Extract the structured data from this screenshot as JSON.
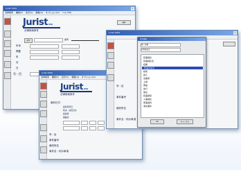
{
  "app": {
    "title": "Jurist 2000",
    "logo_main": "Jurist",
    "logo_sub": "DVD"
  },
  "window1": {
    "title": "Jurist 2000",
    "menu": [
      "法律検索",
      "書誌(F)",
      "表示(V)",
      "移動(G)",
      "オプション(O)",
      "ヘルプ(H)"
    ],
    "heading": "法律検索条件",
    "row_labels": [
      "年号",
      "掲載",
      "年",
      "月",
      "日"
    ],
    "sections": [
      "号・目",
      "事件番号",
      "裁判所名",
      "事件名・判示事項"
    ],
    "controls": [
      "条件",
      "番号"
    ],
    "right_button": "検索"
  },
  "window2": {
    "title": "Jurist 2000",
    "menu": [
      "法律検索",
      "書誌(F)",
      "表示(V)",
      "移動(G)",
      "オプション(O)"
    ],
    "heading": "法律検索条件",
    "field_label": "裁判日付",
    "sections": [
      "号・目",
      "事件番号",
      "裁判所名",
      "事件名・判示事項"
    ],
    "options": [
      "裁判年月日",
      "判決・決定日付",
      "裁判所",
      "掲載誌"
    ]
  },
  "window3": {
    "title": "Jurist 2000",
    "heading": "法律検索条件",
    "sections": [
      "号・目",
      "事件番号",
      "裁判所名",
      "事件名・判示事項"
    ],
    "dialog": {
      "title": "索引選択",
      "field1": "第一分類",
      "field2": "民事訴訟法",
      "tree_items": [
        "民事訴訟",
        "民事訴訟法",
        "証拠",
        "判決の効力",
        "総則",
        "訴え",
        "当事者",
        "上訴",
        "再審",
        "執行",
        "保全",
        "民事調停",
        "人事訴訟",
        "家事審判",
        "非訟事件"
      ],
      "selected_index": 3,
      "ok_label": "OK",
      "cancel_label": "キャンセル"
    }
  }
}
